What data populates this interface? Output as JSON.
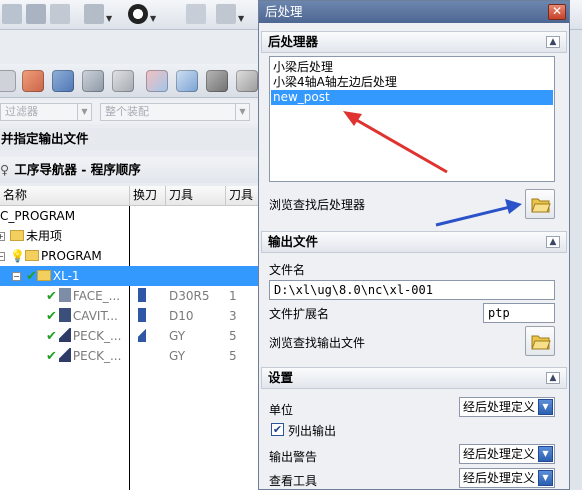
{
  "app": {
    "filter_combo": "过滤器",
    "assembly_combo": "整个装配",
    "outfile_header": "并指定输出文件",
    "navigator_title": "工序导航器 - 程序顺序",
    "columns": {
      "name": "名称",
      "tool_change": "换刀",
      "tool": "刀具",
      "tool_no": "刀具"
    },
    "tree": [
      {
        "name": "C_PROGRAM",
        "tool": "",
        "num": ""
      },
      {
        "name": "未用项",
        "tool": "",
        "num": ""
      },
      {
        "name": "PROGRAM",
        "tool": "",
        "num": ""
      },
      {
        "name": "XL-1",
        "tool": "",
        "num": ""
      },
      {
        "name": "FACE_...",
        "tool": "D30R5",
        "num": "1"
      },
      {
        "name": "CAVIT...",
        "tool": "D10",
        "num": "3"
      },
      {
        "name": "PECK_...",
        "tool": "GY",
        "num": "5"
      },
      {
        "name": "PECK_...",
        "tool": "GY",
        "num": "5"
      }
    ]
  },
  "dialog": {
    "title": "后处理",
    "postprocessor_section": "后处理器",
    "postprocessors": [
      "小梁后处理",
      "小梁4轴A轴左边后处理",
      "new_post"
    ],
    "selected_postprocessor": "new_post",
    "browse_post_label": "浏览查找后处理器",
    "output_section": "输出文件",
    "filename_label": "文件名",
    "filename_value": "D:\\xl\\ug\\8.0\\nc\\xl-001",
    "ext_label": "文件扩展名",
    "ext_value": "ptp",
    "browse_output_label": "浏览查找输出文件",
    "settings_section": "设置",
    "unit_label": "单位",
    "unit_value": "经后处理定义",
    "list_output_label": "列出输出",
    "list_output_checked": true,
    "warning_label": "输出警告",
    "warning_value": "经后处理定义",
    "review_label": "查看工具",
    "review_value": "经后处理定义"
  }
}
